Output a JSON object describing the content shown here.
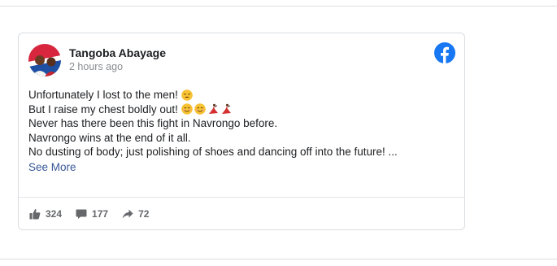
{
  "post": {
    "author": "Tangoba Abayage",
    "time": "2 hours ago",
    "lines": [
      "Unfortunately I lost to the men!",
      "But I raise my chest boldly out!",
      "Never has there been this fight in Navrongo before.",
      "Navrongo wins at the end of it all.",
      "No dusting of body; just polishing of shoes and dancing off into the future! ..."
    ],
    "see_more": "See More",
    "emoji": {
      "line1": [
        "weary-face-emoji"
      ],
      "line2": [
        "smiling-face-emoji",
        "smiling-face-emoji",
        "dancer-emoji",
        "dancer-emoji"
      ]
    },
    "stats": {
      "likes": "324",
      "comments": "177",
      "shares": "72"
    },
    "colors": {
      "facebook_blue": "#1877f2",
      "link": "#385898",
      "muted": "#65676b"
    }
  }
}
